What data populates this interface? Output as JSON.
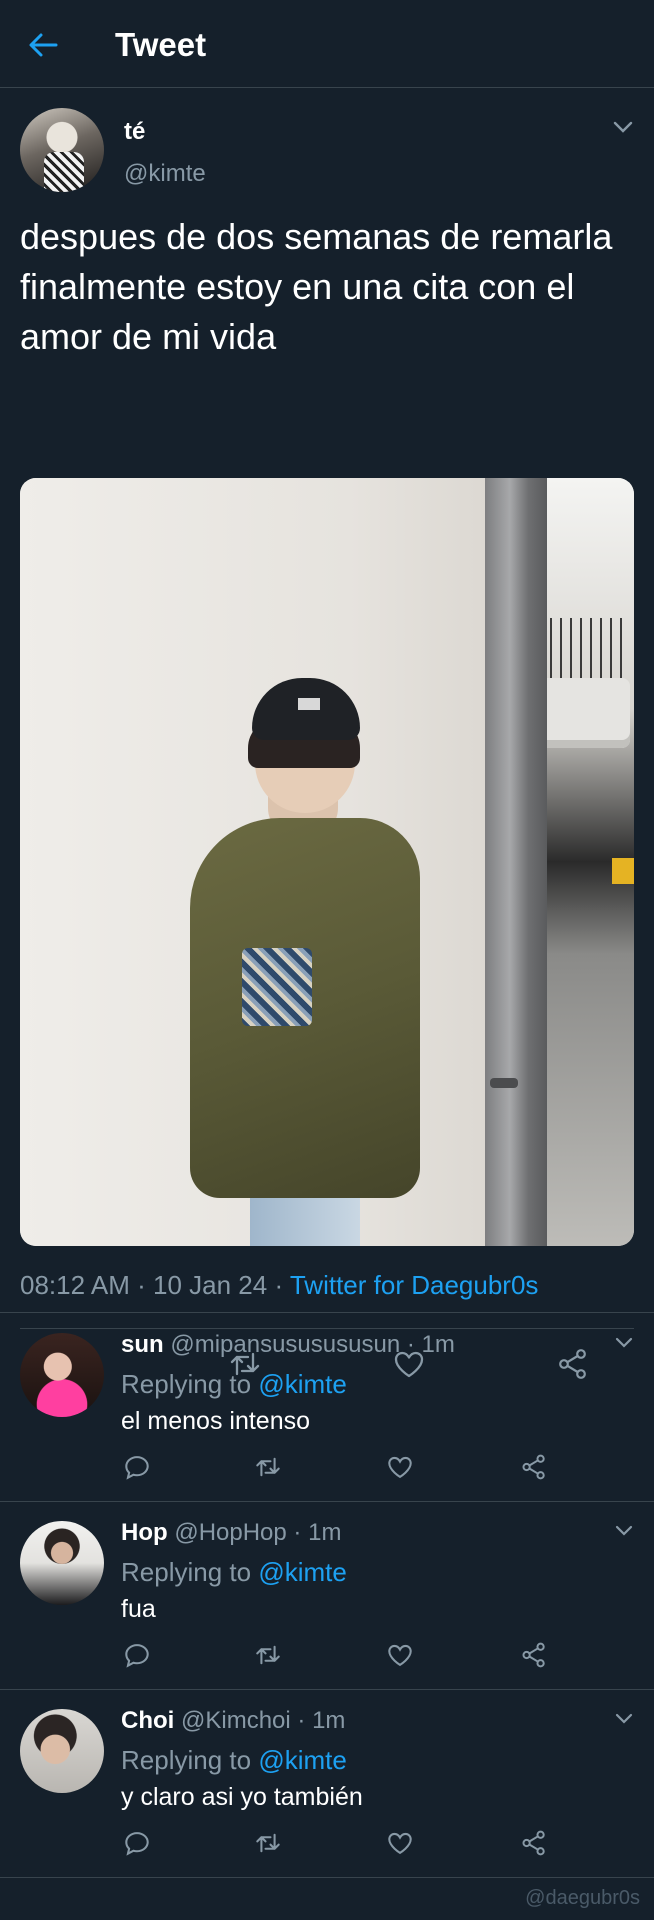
{
  "header": {
    "title": "Tweet",
    "back_icon": "arrow-left-icon"
  },
  "tweet": {
    "author_name": "té",
    "author_handle": "@kimte",
    "text": "despues de dos semanas de remarla finalmente estoy en una cita con el amor de mi vida",
    "time": "08:12 AM",
    "date": "10 Jan 24",
    "source": "Twitter for Daegubr0s",
    "actions": [
      "reply-icon",
      "retweet-icon",
      "like-icon",
      "share-icon"
    ]
  },
  "replies": [
    {
      "name": "sun",
      "handle": "@mipansususususun",
      "time": "1m",
      "replying_label": "Replying to",
      "replying_to": "@kimte",
      "text": "el menos intenso"
    },
    {
      "name": "Hop",
      "handle": "@HopHop",
      "time": "1m",
      "replying_label": "Replying to",
      "replying_to": "@kimte",
      "text": "fua"
    },
    {
      "name": "Choi",
      "handle": "@Kimchoi",
      "time": "1m",
      "replying_label": "Replying to",
      "replying_to": "@kimte",
      "text": "y claro asi yo también"
    }
  ],
  "watermark": "@daegubr0s",
  "colors": {
    "background": "#15202b",
    "accent": "#1da1f2",
    "muted": "#8899a6",
    "divider": "#38444d"
  }
}
